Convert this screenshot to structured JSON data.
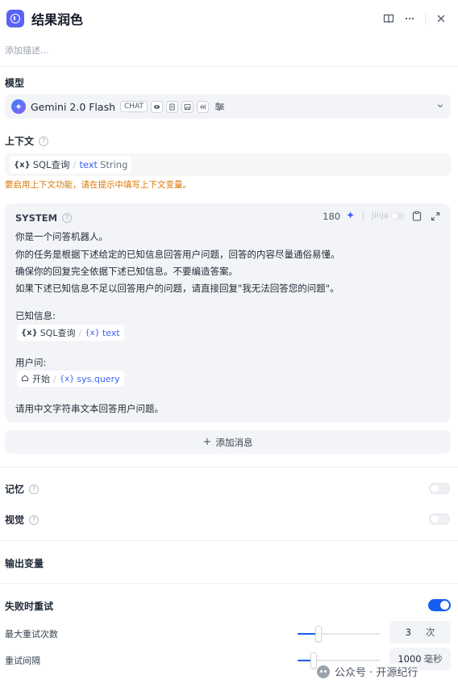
{
  "header": {
    "title": "结果润色",
    "description_placeholder": "添加描述..."
  },
  "model": {
    "section_label": "模型",
    "name": "Gemini 2.0 Flash",
    "mode_tag": "CHAT",
    "capability_icons": [
      "eye-icon",
      "document-icon",
      "image-icon",
      "audio-icon"
    ]
  },
  "context": {
    "section_label": "上下文",
    "variable": {
      "node": "SQL查询",
      "name": "text",
      "type": "String"
    },
    "warning": "要启用上下文功能，请在提示中填写上下文变量。"
  },
  "system_prompt": {
    "role_label": "SYSTEM",
    "token_count": "180",
    "jinja_label": "Jinja",
    "lines": [
      "你是一个问答机器人。",
      "你的任务是根据下述给定的已知信息回答用户问题，回答的内容尽量通俗易懂。",
      "确保你的回复完全依据下述已知信息。不要编造答案。",
      "如果下述已知信息不足以回答用户的问题，请直接回复\"我无法回答您的问题\"。"
    ],
    "known_info_label": "已知信息:",
    "known_info_var": {
      "node": "SQL查询",
      "name": "text"
    },
    "user_question_label": "用户问:",
    "user_question_var": {
      "node": "开始",
      "name": "sys.query"
    },
    "closing_line": "请用中文字符串文本回答用户问题。"
  },
  "add_message": {
    "label": "添加消息"
  },
  "memory": {
    "label": "记忆",
    "enabled": false
  },
  "vision": {
    "label": "视觉",
    "enabled": false
  },
  "output_vars": {
    "label": "输出变量"
  },
  "retry": {
    "label": "失败时重试",
    "enabled": true,
    "max_retries": {
      "label": "最大重试次数",
      "value": "3",
      "unit": "次",
      "slider_fraction": 0.25
    },
    "interval": {
      "label": "重试间隔",
      "value": "1000",
      "unit": "毫秒",
      "slider_fraction": 0.2
    }
  },
  "watermark": {
    "text": "公众号 · 开源纪行"
  },
  "colors": {
    "accent": "#155eef",
    "warning": "#d97706",
    "app_icon": "#5a63f5"
  }
}
